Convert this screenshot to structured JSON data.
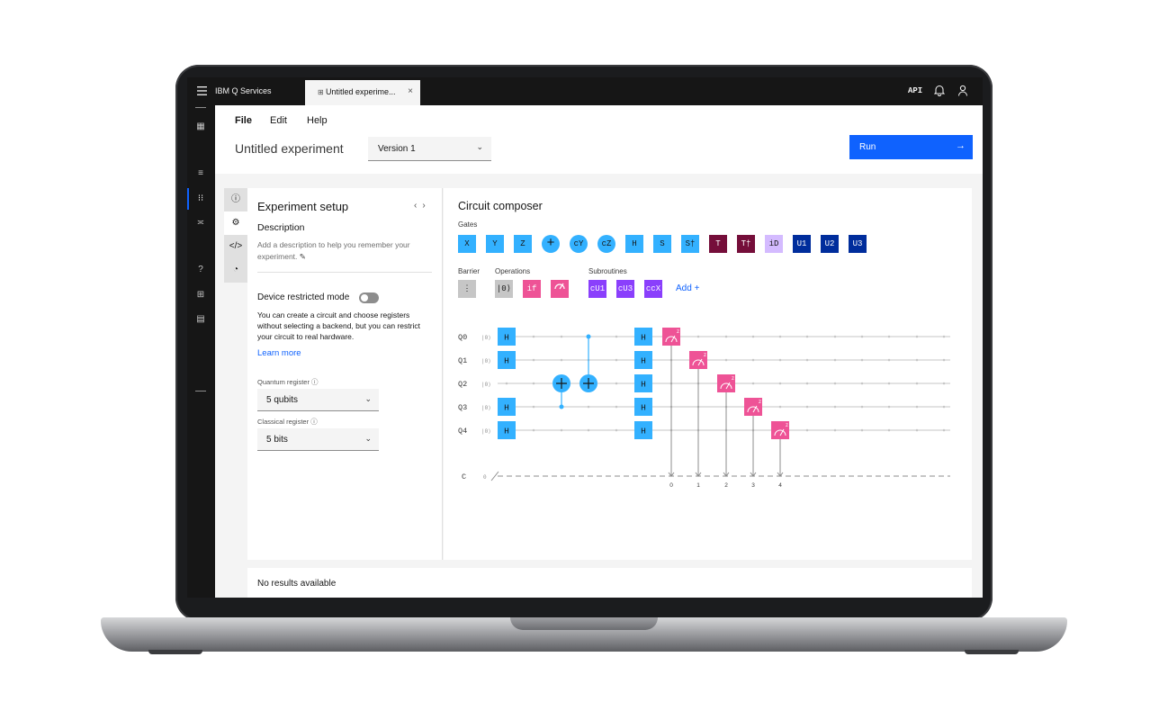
{
  "topbar": {
    "brand": "IBM Q Services",
    "tab_label": "Untitled experime...",
    "tab_close": "×",
    "api": "API"
  },
  "menu": {
    "file": "File",
    "edit": "Edit",
    "help": "Help"
  },
  "header": {
    "title": "Untitled experiment",
    "version": "Version 1",
    "run": "Run"
  },
  "setup": {
    "title": "Experiment setup",
    "description_heading": "Description",
    "description_text": "Add a description to help you remember your experiment.",
    "device_mode": "Device restricted mode",
    "device_mode_text": "You can create a circuit and choose registers without selecting a backend, but you can restrict your circuit to real hardware.",
    "learn_more": "Learn more",
    "quantum_register_label": "Quantum register",
    "quantum_register_value": "5 qubits",
    "classical_register_label": "Classical register",
    "classical_register_value": "5 bits"
  },
  "composer": {
    "title": "Circuit composer",
    "gates_label": "Gates",
    "barrier_label": "Barrier",
    "operations_label": "Operations",
    "subroutines_label": "Subroutines",
    "add": "Add +",
    "gates": [
      {
        "label": "X",
        "bg": "#33b1ff",
        "fg": "#161616",
        "shape": "square"
      },
      {
        "label": "Y",
        "bg": "#33b1ff",
        "fg": "#161616",
        "shape": "square"
      },
      {
        "label": "Z",
        "bg": "#33b1ff",
        "fg": "#161616",
        "shape": "square"
      },
      {
        "label": "+",
        "bg": "#33b1ff",
        "fg": "#161616",
        "shape": "circle"
      },
      {
        "label": "cY",
        "bg": "#33b1ff",
        "fg": "#161616",
        "shape": "circle"
      },
      {
        "label": "cZ",
        "bg": "#33b1ff",
        "fg": "#161616",
        "shape": "circle"
      },
      {
        "label": "H",
        "bg": "#33b1ff",
        "fg": "#161616",
        "shape": "square"
      },
      {
        "label": "S",
        "bg": "#33b1ff",
        "fg": "#161616",
        "shape": "square"
      },
      {
        "label": "S†",
        "bg": "#33b1ff",
        "fg": "#161616",
        "shape": "square"
      },
      {
        "label": "T",
        "bg": "#750e3a",
        "fg": "#ffffff",
        "shape": "square"
      },
      {
        "label": "T†",
        "bg": "#750e3a",
        "fg": "#ffffff",
        "shape": "square"
      },
      {
        "label": "iD",
        "bg": "#d4bbff",
        "fg": "#161616",
        "shape": "square"
      },
      {
        "label": "U1",
        "bg": "#002d9c",
        "fg": "#ffffff",
        "shape": "square"
      },
      {
        "label": "U2",
        "bg": "#002d9c",
        "fg": "#ffffff",
        "shape": "square"
      },
      {
        "label": "U3",
        "bg": "#002d9c",
        "fg": "#ffffff",
        "shape": "square"
      }
    ],
    "barrier_gate": "⋮",
    "operations": [
      {
        "label": "|0⟩",
        "bg": "#c6c6c6",
        "fg": "#161616"
      },
      {
        "label": "if",
        "bg": "#ee5396",
        "fg": "#ffffff"
      },
      {
        "label": "measure",
        "bg": "#ee5396",
        "fg": "#ffffff"
      }
    ],
    "subroutines": [
      {
        "label": "cU1",
        "bg": "#8a3ffc",
        "fg": "#ffffff"
      },
      {
        "label": "cU3",
        "bg": "#8a3ffc",
        "fg": "#ffffff"
      },
      {
        "label": "ccX",
        "bg": "#8a3ffc",
        "fg": "#ffffff"
      }
    ],
    "qubits": [
      "Q0",
      "Q1",
      "Q2",
      "Q3",
      "Q4"
    ],
    "qubit_init": "|0⟩",
    "classical": "C",
    "classical_init": "0",
    "classical_bits": [
      "0",
      "1",
      "2",
      "3",
      "4"
    ],
    "h_gate": "H",
    "measure_label": "z"
  },
  "results": {
    "text": "No results available"
  },
  "colors": {
    "accent": "#0f62fe",
    "gate_blue": "#33b1ff",
    "measure_pink": "#ee5396"
  }
}
